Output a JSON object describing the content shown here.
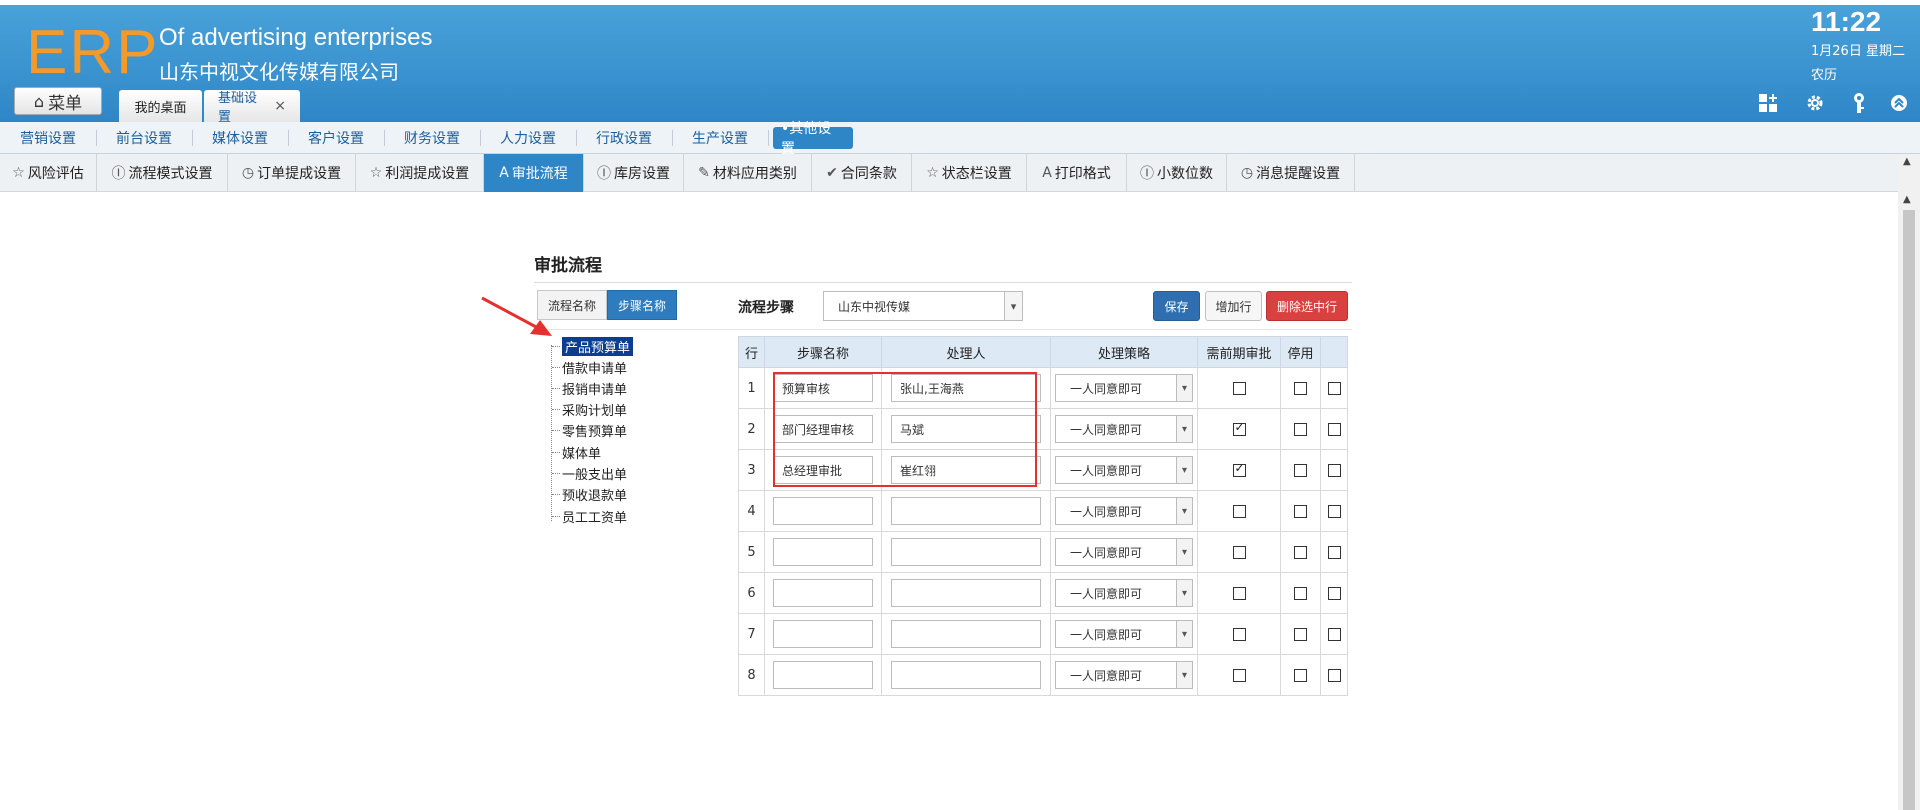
{
  "header": {
    "logo": "ERP",
    "brand_en": "Of advertising enterprises",
    "brand_cn": "山东中视文化传媒有限公司",
    "time": "11:22",
    "date": "1月26日 星期二",
    "lunar": "农历",
    "icons": [
      "grid-add-icon",
      "gear-icon",
      "key-icon",
      "collapse-up-icon"
    ]
  },
  "topbar": {
    "menu_label": "菜单",
    "tabs": [
      {
        "label": "我的桌面"
      },
      {
        "label": "基础设置",
        "close": "×"
      }
    ]
  },
  "mainnav": {
    "items": [
      "营销设置",
      "前台设置",
      "媒体设置",
      "客户设置",
      "财务设置",
      "人力设置",
      "行政设置",
      "生产设置",
      "•其他设置"
    ],
    "active_index": 8
  },
  "subnav": {
    "items": [
      {
        "label": "风险评估",
        "icon": "☆"
      },
      {
        "label": "流程模式设置",
        "icon": "Ⓘ"
      },
      {
        "label": "订单提成设置",
        "icon": "◷"
      },
      {
        "label": "利润提成设置",
        "icon": "☆"
      },
      {
        "label": "审批流程",
        "icon": "A"
      },
      {
        "label": "库房设置",
        "icon": "Ⓘ"
      },
      {
        "label": "材料应用类别",
        "icon": "✎"
      },
      {
        "label": "合同条款",
        "icon": "✔"
      },
      {
        "label": "状态栏设置",
        "icon": "☆"
      },
      {
        "label": "打印格式",
        "icon": "A"
      },
      {
        "label": "小数位数",
        "icon": "Ⓘ"
      },
      {
        "label": "消息提醒设置",
        "icon": "◷"
      }
    ],
    "active_index": 4
  },
  "content": {
    "title": "审批流程",
    "toggle_flow": "流程名称",
    "toggle_step": "步骤名称",
    "step_label": "流程步骤",
    "company": "山东中视传媒",
    "buttons": {
      "save": "保存",
      "add_row": "增加行",
      "delete_row": "删除选中行"
    }
  },
  "tree": {
    "items": [
      "产品预算单",
      "借款申请单",
      "报销申请单",
      "采购计划单",
      "零售预算单",
      "媒体单",
      "一般支出单",
      "预收退款单",
      "员工工资单"
    ],
    "selected_index": 0
  },
  "grid": {
    "headers": [
      "行",
      "步骤名称",
      "处理人",
      "处理策略",
      "需前期审批",
      "停用",
      ""
    ],
    "rows": [
      {
        "n": "1",
        "step": "预算审核",
        "handler": "张山,王海燕",
        "strategy": "一人同意即可",
        "prior": false,
        "disabled": false,
        "extra": false
      },
      {
        "n": "2",
        "step": "部门经理审核",
        "handler": "马斌",
        "strategy": "一人同意即可",
        "prior": true,
        "disabled": false,
        "extra": false
      },
      {
        "n": "3",
        "step": "总经理审批",
        "handler": "崔红翎",
        "strategy": "一人同意即可",
        "prior": true,
        "disabled": false,
        "extra": false
      },
      {
        "n": "4",
        "step": "",
        "handler": "",
        "strategy": "一人同意即可",
        "prior": false,
        "disabled": false,
        "extra": false
      },
      {
        "n": "5",
        "step": "",
        "handler": "",
        "strategy": "一人同意即可",
        "prior": false,
        "disabled": false,
        "extra": false
      },
      {
        "n": "6",
        "step": "",
        "handler": "",
        "strategy": "一人同意即可",
        "prior": false,
        "disabled": false,
        "extra": false
      },
      {
        "n": "7",
        "step": "",
        "handler": "",
        "strategy": "一人同意即可",
        "prior": false,
        "disabled": false,
        "extra": false
      },
      {
        "n": "8",
        "step": "",
        "handler": "",
        "strategy": "一人同意即可",
        "prior": false,
        "disabled": false,
        "extra": false
      }
    ]
  },
  "colors": {
    "header": "#3b95d2",
    "accent": "#2e86c7",
    "logo": "#f39a2b",
    "danger": "#d94040",
    "highlight": "#e53030"
  }
}
